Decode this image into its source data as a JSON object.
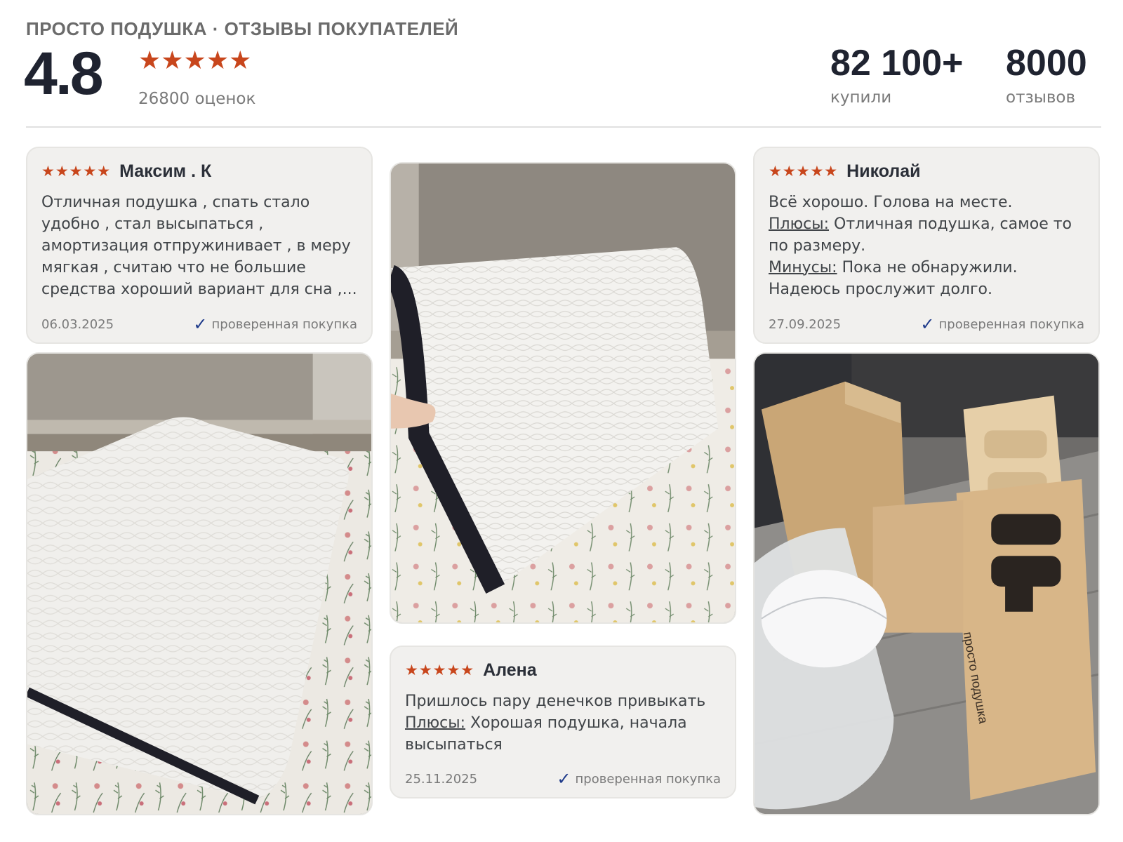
{
  "header": {
    "brand": "ПРОСТО ПОДУШКА · ОТЗЫВЫ ПОКУПАТЕЛЕЙ",
    "rating": "4.8",
    "stars": "★★★★★",
    "ratings_count": "26800 оценок",
    "stats": [
      {
        "value": "82 100+",
        "label": "купили"
      },
      {
        "value": "8000",
        "label": "отзывов"
      }
    ]
  },
  "reviews": [
    {
      "stars": "★★★★★",
      "author": "Максим . К",
      "text": "Отличная подушка , спать стало удобно , стал высыпаться , амортизация отпружинивает , в меру мягкая , считаю что не большие средства хороший вариант для сна ,...",
      "date": "06.03.2025",
      "verified": "проверенная покупка"
    },
    {
      "stars": "★★★★★",
      "author": "Николай",
      "text": "Всё хорошо. Голова на месте.",
      "pros_label": "Плюсы:",
      "pros": "Отличная подушка, самое то по размеру.",
      "cons_label": "Минусы:",
      "cons": "Пока не обнаружили. Надеюсь прослужит долго.",
      "date": "27.09.2025",
      "verified": "проверенная покупка"
    },
    {
      "stars": "★★★★★",
      "author": "Алена",
      "text": "Пришлось пару денечков привыкать",
      "pros_label": "Плюсы:",
      "pros": "Хорошая подушка, начала высыпаться",
      "date": "25.11.2025",
      "verified": "проверенная покупка"
    }
  ],
  "photos": {
    "box_print": "просто подушка"
  },
  "colors": {
    "star": "#c8461c",
    "check": "#1e3a8a",
    "card_bg": "#f1f0ee"
  }
}
